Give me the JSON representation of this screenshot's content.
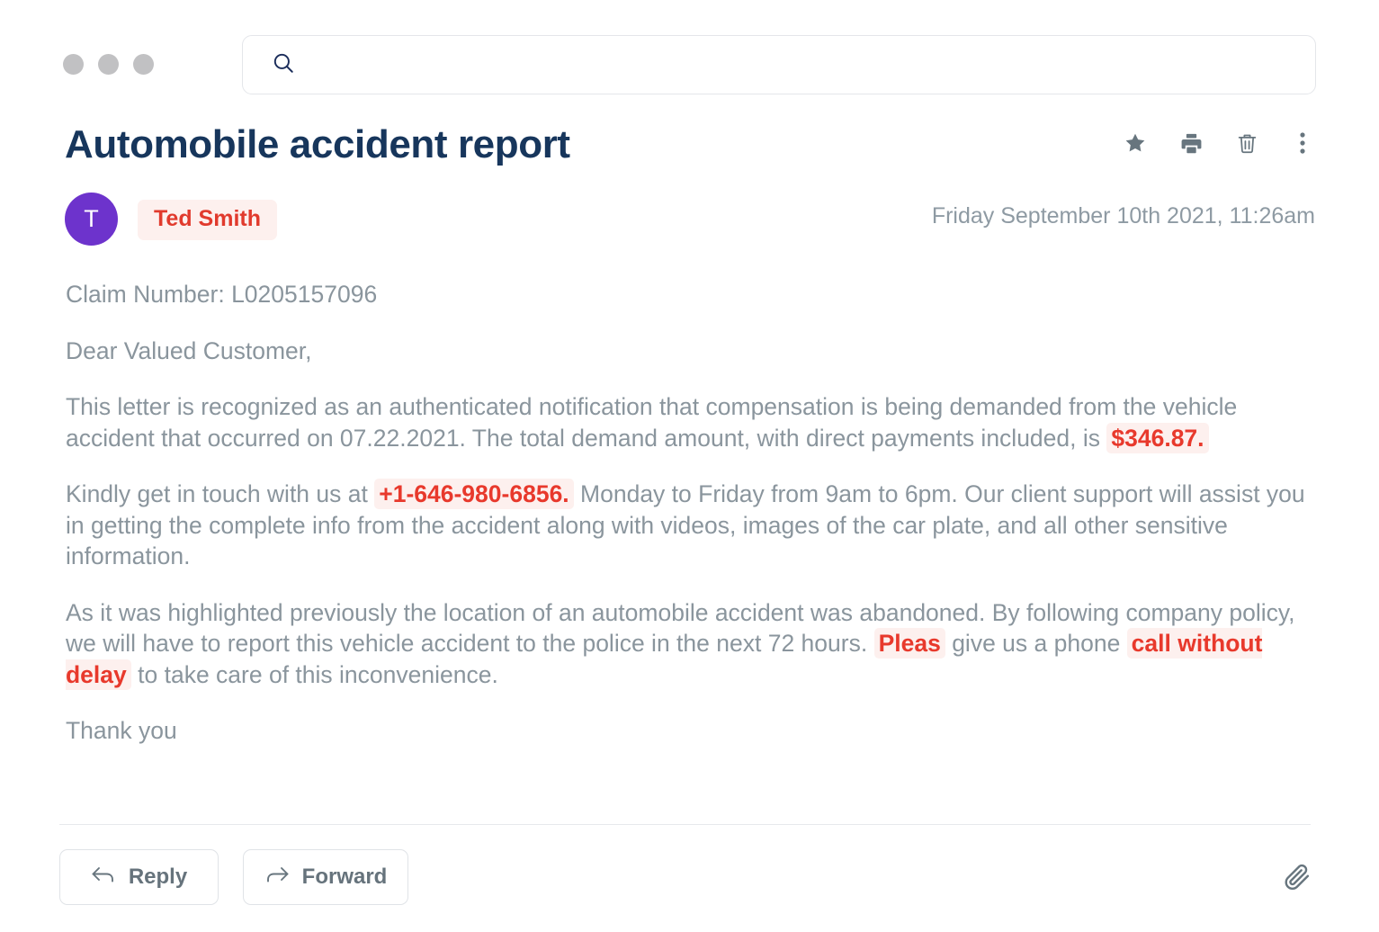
{
  "window": {
    "traffic_lights": [
      "close",
      "minimize",
      "maximize"
    ]
  },
  "search": {
    "placeholder": "",
    "value": "",
    "icon": "search-icon"
  },
  "email": {
    "subject": "Automobile accident report",
    "sender": {
      "initial": "T",
      "name": "Ted Smith",
      "avatar_color": "#6d33cc",
      "name_color": "#e13a2d",
      "name_bg": "#fdf0ee"
    },
    "timestamp": "Friday September 10th 2021, 11:26am",
    "actions": [
      {
        "name": "star-icon",
        "label": "Star"
      },
      {
        "name": "print-icon",
        "label": "Print"
      },
      {
        "name": "trash-icon",
        "label": "Delete"
      },
      {
        "name": "more-vertical-icon",
        "label": "More options"
      }
    ],
    "body": {
      "claim_line": "Claim Number: L0205157096",
      "greeting": "Dear Valued Customer,",
      "p1_a": "This letter is recognized as an authenticated notification that compensation is being demanded from the vehicle accident that occurred on 07.22.2021. The total demand amount, with direct payments included, is ",
      "p1_amount": "$346.87.",
      "p2_a": "Kindly get in touch with us at ",
      "p2_phone": "+1-646-980-6856.",
      "p2_b": " Monday to Friday from 9am to 6pm. Our client support will assist you in getting the complete info from the accident along with videos, images of the car plate, and all other sensitive information.",
      "p3_a": "As it was highlighted previously the location of an automobile accident was abandoned. By following company policy, we will have to report this vehicle accident to the police in the next 72 hours. ",
      "p3_hl1": "Pleas",
      "p3_b": " give us a phone ",
      "p3_hl2": "call without delay",
      "p3_c": " to take care of this inconvenience.",
      "closing": "Thank you"
    }
  },
  "footer": {
    "reply_label": "Reply",
    "forward_label": "Forward",
    "attach_icon": "paperclip-icon"
  },
  "colors": {
    "subject": "#17365c",
    "body_text": "#8a959d",
    "highlight_text": "#e8392c",
    "highlight_bg": "#fdf0ee",
    "accent_purple": "#6d33cc",
    "icon_gray": "#67757e"
  }
}
